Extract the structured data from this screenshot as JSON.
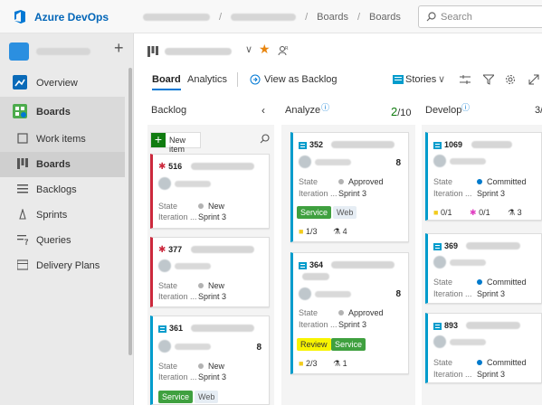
{
  "topbar": {
    "brand": "Azure DevOps",
    "crumbs": [
      "Boards",
      "Boards"
    ],
    "search_placeholder": "Search"
  },
  "sidebar": {
    "items": [
      {
        "label": "Overview"
      },
      {
        "label": "Boards"
      },
      {
        "label": "Work items"
      },
      {
        "label": "Boards"
      },
      {
        "label": "Backlogs"
      },
      {
        "label": "Sprints"
      },
      {
        "label": "Queries"
      },
      {
        "label": "Delivery Plans"
      }
    ]
  },
  "tabs": {
    "board": "Board",
    "analytics": "Analytics",
    "view_backlog": "View as Backlog",
    "stories": "Stories"
  },
  "columns": {
    "backlog": {
      "title": "Backlog",
      "new_item": "New item"
    },
    "analyze": {
      "title": "Analyze",
      "count": "2",
      "limit": "/10"
    },
    "develop": {
      "title": "Develop",
      "count": "3/"
    }
  },
  "labels": {
    "state": "State",
    "iteration": "Iteration ..."
  },
  "cards": {
    "c516": {
      "id": "516",
      "state": "New",
      "iteration": "Sprint 3"
    },
    "c377": {
      "id": "377",
      "state": "New",
      "iteration": "Sprint 3"
    },
    "c361": {
      "id": "361",
      "points": "8",
      "state": "New",
      "iteration": "Sprint 3",
      "tags": [
        "Service",
        "Web"
      ]
    },
    "c352": {
      "id": "352",
      "points": "8",
      "state": "Approved",
      "iteration": "Sprint 3",
      "tags": [
        "Service",
        "Web"
      ],
      "tasks": "1/3",
      "tests": "4"
    },
    "c364": {
      "id": "364",
      "points": "8",
      "state": "Approved",
      "iteration": "Sprint 3",
      "tags": [
        "Review",
        "Service"
      ],
      "tasks": "2/3",
      "tests": "1"
    },
    "c1069": {
      "id": "1069",
      "state": "Committed",
      "iteration": "Sprint 3",
      "tasks": "0/1",
      "bugs": "0/1",
      "tests": "3"
    },
    "c369": {
      "id": "369",
      "state": "Committed",
      "iteration": "Sprint 3"
    },
    "c893": {
      "id": "893",
      "state": "Committed",
      "iteration": "Sprint 3"
    }
  },
  "colors": {
    "accent": "#0078d4",
    "bug": "#cc293d",
    "story": "#009ccc",
    "green": "#107c10",
    "committed": "#007acc",
    "new": "#b2b2b2"
  }
}
